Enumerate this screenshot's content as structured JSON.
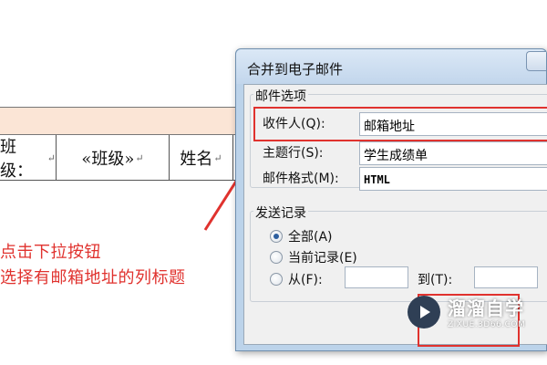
{
  "document": {
    "cells": [
      "班级：",
      "«班级»",
      "姓名"
    ],
    "paragraph_mark": "↵"
  },
  "annotation": {
    "line1": "点击下拉按钮",
    "line2": "选择有邮箱地址的列标题",
    "color": "#e0322e"
  },
  "dialog": {
    "title": "合并到电子邮件",
    "mail_options": {
      "group_label": "邮件选项",
      "recipient_label": "收件人(Q):",
      "recipient_value": "邮箱地址",
      "subject_label": "主题行(S):",
      "subject_value": "学生成绩单",
      "format_label": "邮件格式(M):",
      "format_value": "HTML"
    },
    "send_records": {
      "group_label": "发送记录",
      "all_label": "全部(A)",
      "current_label": "当前记录(E)",
      "from_label": "从(F):",
      "to_label": "到(T):",
      "selected": "all"
    }
  },
  "watermark": {
    "name": "溜溜自学",
    "url": "ZIXUE.3D66.COM"
  }
}
